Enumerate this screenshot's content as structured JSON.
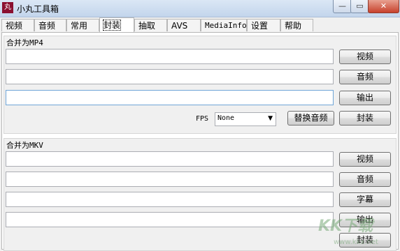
{
  "window": {
    "title": "小丸工具箱",
    "icon_label": "丸"
  },
  "tabs": [
    "视频",
    "音频",
    "常用",
    "封装",
    "抽取",
    "AVS",
    "MediaInfo",
    "设置",
    "帮助"
  ],
  "active_tab": "封装",
  "mp4": {
    "group_label": "合并为MP4",
    "video_button": "视频",
    "audio_button": "音频",
    "output_button": "输出",
    "fps_label": "FPS",
    "fps_value": "None",
    "replace_audio_button": "替换音频",
    "mux_button": "封装"
  },
  "mkv": {
    "group_label": "合并为MKV",
    "video_button": "视频",
    "audio_button": "音频",
    "subtitle_button": "字幕",
    "output_button": "输出",
    "mux_button": "封装"
  },
  "watermark": {
    "text": "KK下载",
    "sub": "www.kkx.net"
  }
}
